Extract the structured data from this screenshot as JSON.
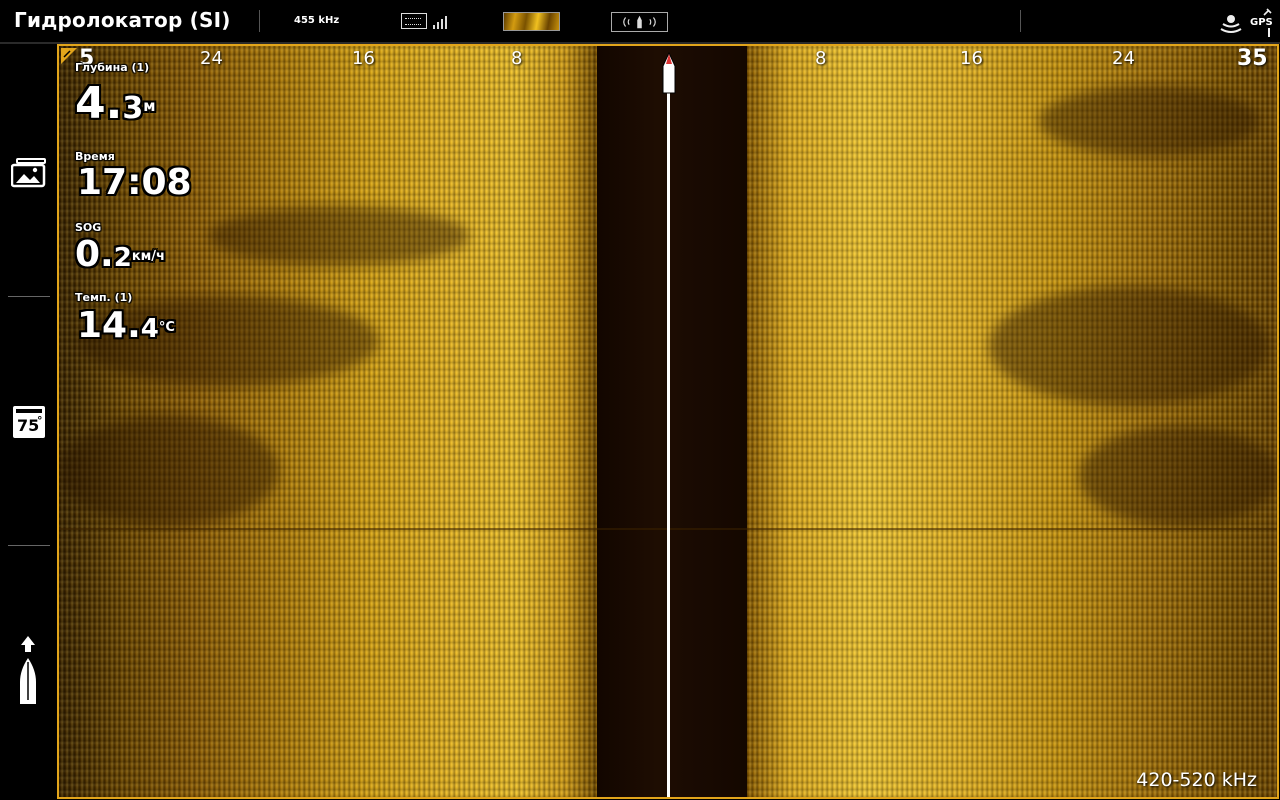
{
  "header": {
    "title": "Гидролокатор (SI)",
    "frequency": "455 kHz",
    "gps_label": "GPS"
  },
  "sidebar": {
    "temp_badge": "75",
    "temp_badge_degree": "°"
  },
  "range": {
    "left_end": "5",
    "left_ticks": [
      "24",
      "16",
      "8"
    ],
    "right_ticks": [
      "8",
      "16",
      "24"
    ],
    "right_end": "35"
  },
  "readouts": {
    "depth": {
      "label": "Глубина (1)",
      "value_int": "4.",
      "value_dec": "3",
      "unit": "м"
    },
    "time": {
      "label": "Время",
      "value": "17:08"
    },
    "sog": {
      "label": "SOG",
      "value_int": "0.",
      "value_dec": "2",
      "unit": "км/ч"
    },
    "temp": {
      "label": "Темп. (1)",
      "value_int": "14.",
      "value_dec": "4",
      "unit": "°C"
    }
  },
  "footer": {
    "frequency": "420-520 kHz"
  },
  "colors": {
    "accent_border": "#e2a51b",
    "sonar_gold": "#f0c22c",
    "water_column": "#1a0b02",
    "bow_red": "#d33"
  }
}
